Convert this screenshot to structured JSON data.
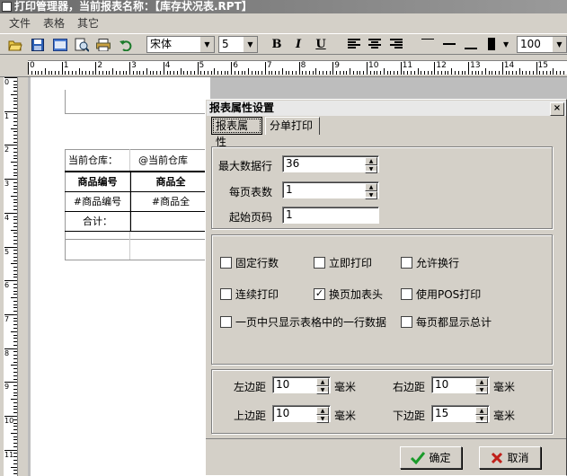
{
  "window": {
    "title": "打印管理器，当前报表名称：【库存状况表.RPT】"
  },
  "menu": [
    {
      "label": "文件"
    },
    {
      "label": "表格"
    },
    {
      "label": "其它"
    }
  ],
  "toolbar": {
    "font_name": "宋体",
    "font_size": "5",
    "bold": "B",
    "italic": "I",
    "underline": "U",
    "zoom": "100"
  },
  "ruler": {
    "numbers": [
      "0",
      "1",
      "2",
      "3",
      "4",
      "5",
      "6",
      "7",
      "8",
      "9",
      "10",
      "11",
      "12",
      "13",
      "14",
      "15"
    ],
    "vnumbers": [
      "0",
      "1",
      "2",
      "3",
      "4",
      "5",
      "6",
      "7",
      "8",
      "9",
      "10",
      "11"
    ]
  },
  "report": {
    "warehouse_label": "当前仓库：",
    "warehouse_value": "@当前仓库",
    "col1_header": "商品编号",
    "col2_header": "商品全",
    "row_code": "#商品编号",
    "row_name": "#商品全",
    "total_label": "合计："
  },
  "dialog": {
    "title": "报表属性设置",
    "close": "×",
    "tabs": [
      {
        "label": "报表属性"
      },
      {
        "label": "分单打印"
      }
    ],
    "max_rows_label": "最大数据行",
    "max_rows_value": "36",
    "tables_per_page_label": "每页表数",
    "tables_per_page_value": "1",
    "start_page_label": "起始页码",
    "start_page_value": "1",
    "options": [
      {
        "label": "固定行数",
        "checked": false
      },
      {
        "label": "立即打印",
        "checked": false
      },
      {
        "label": "允许换行",
        "checked": false
      },
      {
        "label": "连续打印",
        "checked": false
      },
      {
        "label": "换页加表头",
        "checked": true
      },
      {
        "label": "使用POS打印",
        "checked": false
      },
      {
        "label": "一页中只显示表格中的一行数据",
        "checked": false
      },
      {
        "label": "每页都显示总计",
        "checked": false
      }
    ],
    "margins": {
      "left_label": "左边距",
      "left_value": "10",
      "right_label": "右边距",
      "right_value": "10",
      "top_label": "上边距",
      "top_value": "10",
      "bottom_label": "下边距",
      "bottom_value": "15",
      "unit": "毫米"
    },
    "ok_label": "确定",
    "cancel_label": "取消",
    "check_mark": "✓"
  }
}
